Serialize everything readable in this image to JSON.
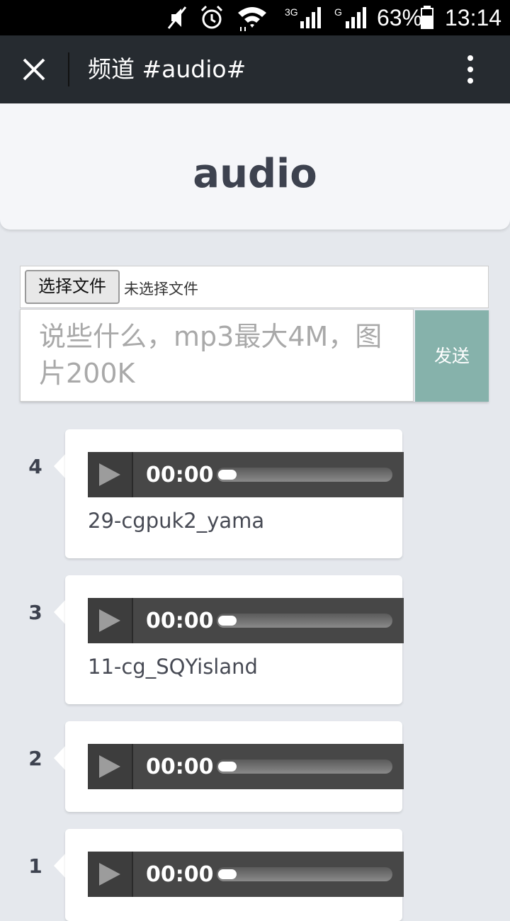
{
  "status_bar": {
    "battery": "63%",
    "time": "13:14",
    "network_1": "3G",
    "network_2": "G",
    "icons": [
      "mute-icon",
      "alarm-icon",
      "wifi-icon",
      "signal-3g-icon",
      "signal-g-icon",
      "battery-icon"
    ]
  },
  "app_bar": {
    "title": "频道 #audio#",
    "close_icon": "close-icon",
    "more_icon": "more-vert-icon"
  },
  "header": {
    "title": "audio"
  },
  "composer": {
    "file_button_label": "选择文件",
    "file_status": "未选择文件",
    "placeholder": "说些什么，mp3最大4M，图片200K",
    "send_label": "发送",
    "send_color": "#86b2ab"
  },
  "posts": [
    {
      "number": "4",
      "time": "00:00",
      "filename": "29-cgpuk2_yama"
    },
    {
      "number": "3",
      "time": "00:00",
      "filename": "11-cg_SQYisland"
    },
    {
      "number": "2",
      "time": "00:00",
      "filename": ""
    },
    {
      "number": "1",
      "time": "00:00",
      "filename": ""
    }
  ]
}
